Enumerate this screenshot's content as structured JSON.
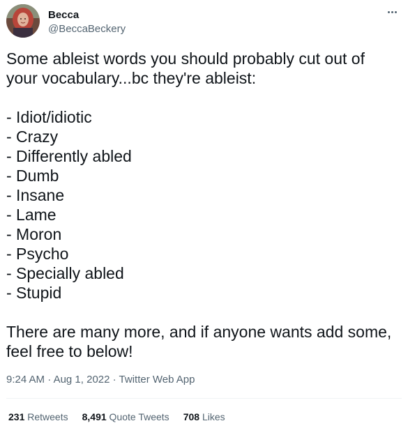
{
  "author": {
    "display_name": "Becca",
    "handle": "@BeccaBeckery",
    "avatar_icon": "profile-photo"
  },
  "more_icon": "more-options-icon",
  "tweet": {
    "intro": "Some ableist words you should probably cut out of your vocabulary...bc they're ableist:",
    "list": [
      "- Idiot/idiotic",
      "- Crazy",
      "- Differently abled",
      "- Dumb",
      "- Insane",
      "- Lame",
      "- Moron",
      "- Psycho",
      "- Specially abled",
      "- Stupid"
    ],
    "outro": "There are many more, and if anyone wants add some, feel free to below!"
  },
  "meta": {
    "time": "9:24 AM",
    "sep1": " · ",
    "date": "Aug 1, 2022",
    "sep2": " · ",
    "source": "Twitter Web App"
  },
  "stats": {
    "retweets_count": "231",
    "retweets_label": "Retweets",
    "quotes_count": "8,491",
    "quotes_label": "Quote Tweets",
    "likes_count": "708",
    "likes_label": "Likes"
  },
  "colors": {
    "text": "#0f1419",
    "secondary": "#536471",
    "divider": "#eff3f4"
  }
}
